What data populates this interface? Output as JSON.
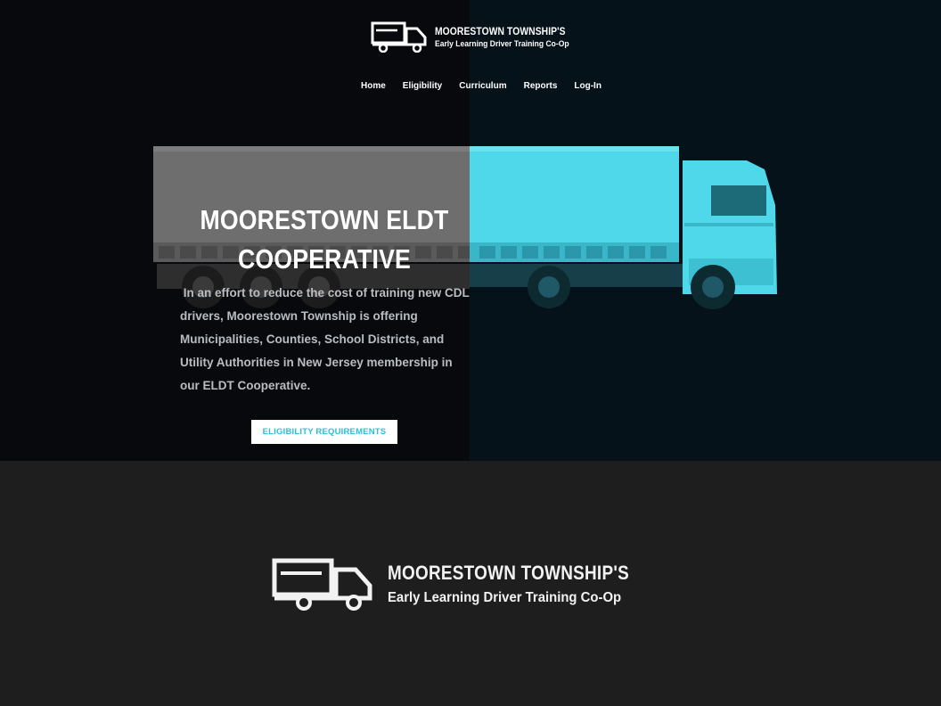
{
  "header": {
    "brand_name": "MOORESTOWN TOWNSHIP'S",
    "brand_sub": "Early Learning Driver Training Co-Op",
    "logo_icon": "truck-icon"
  },
  "nav": {
    "items": [
      {
        "label": "Home"
      },
      {
        "label": "Eligibility"
      },
      {
        "label": "Curriculum"
      },
      {
        "label": "Reports"
      },
      {
        "label": "Log-In"
      }
    ]
  },
  "hero": {
    "title": "MOORESTOWN ELDT COOPERATIVE",
    "body": " In an effort to reduce the cost of training new CDL drivers, Moorestown Township is offering Municipalities, Counties, School Districts, and Utility Authorities in New Jersey membership in our ELDT Cooperative.",
    "button_label": "ELIGIBILITY REQUIREMENTS",
    "accent_color": "#4fd8ea"
  },
  "footer": {
    "brand_name": "MOORESTOWN TOWNSHIP'S",
    "brand_sub": "Early Learning Driver Training Co-Op",
    "logo_icon": "truck-icon"
  }
}
